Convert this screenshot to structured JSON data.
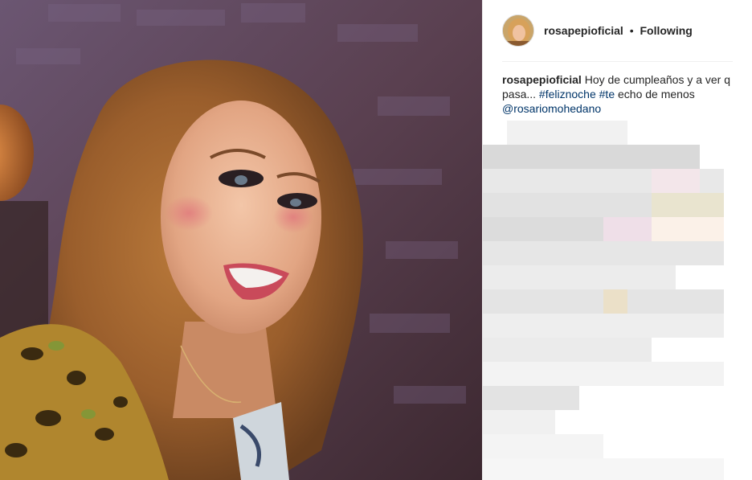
{
  "post": {
    "username": "rosapepioficial",
    "separator": "•",
    "follow_status": "Following",
    "caption": {
      "username": "rosapepioficial",
      "text_1": "Hoy de cumpleaños y a ver q pasa... ",
      "hashtag_1": "#feliznoche",
      "space": " ",
      "hashtag_2": "#te",
      "text_2": " echo de menos ",
      "mention": "@rosariomohedano"
    }
  },
  "colors": {
    "link": "#003569",
    "text": "#262626",
    "divider": "#efefef"
  }
}
